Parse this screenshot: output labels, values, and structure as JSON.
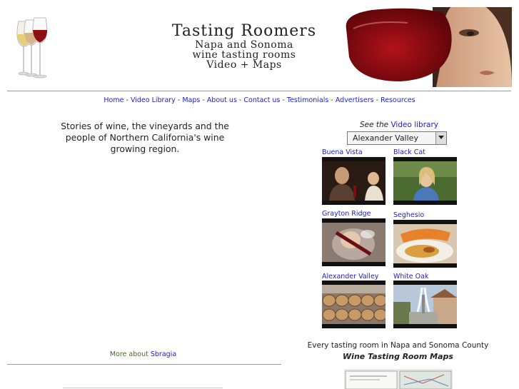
{
  "header": {
    "title": "Tasting Roomers",
    "subtitle_lines": [
      "Napa and Sonoma",
      "wine tasting rooms",
      "Video + Maps"
    ]
  },
  "nav": {
    "items": [
      "Home",
      "Video Library",
      "Maps",
      "About us",
      "Contact us",
      "Testimonials",
      "Advertisers",
      "Resources"
    ],
    "separator": "-"
  },
  "intro": {
    "text": "Stories of wine, the vineyards and the people of Northern California's wine growing region."
  },
  "more_about": {
    "prefix": "More about",
    "link": "Sbragia"
  },
  "video_library": {
    "prefix": "See the",
    "link": "Video library",
    "selected_region": "Alexander Valley",
    "videos": [
      {
        "label": "Buena Vista"
      },
      {
        "label": "Black Cat"
      },
      {
        "label": "Grayton Ridge"
      },
      {
        "label": "Seghesio"
      },
      {
        "label": "Alexander Valley"
      },
      {
        "label": "White Oak"
      }
    ]
  },
  "maps_promo": {
    "line1": "Every tasting room in Napa and Sonoma County",
    "line2": "Wine Tasting Room Maps"
  },
  "colors": {
    "link": "#2020c8",
    "rule": "#9a9a9a",
    "wine_red": "#8e0f14"
  },
  "icons": [
    "wine-glasses-logo",
    "select-arrow-icon"
  ]
}
